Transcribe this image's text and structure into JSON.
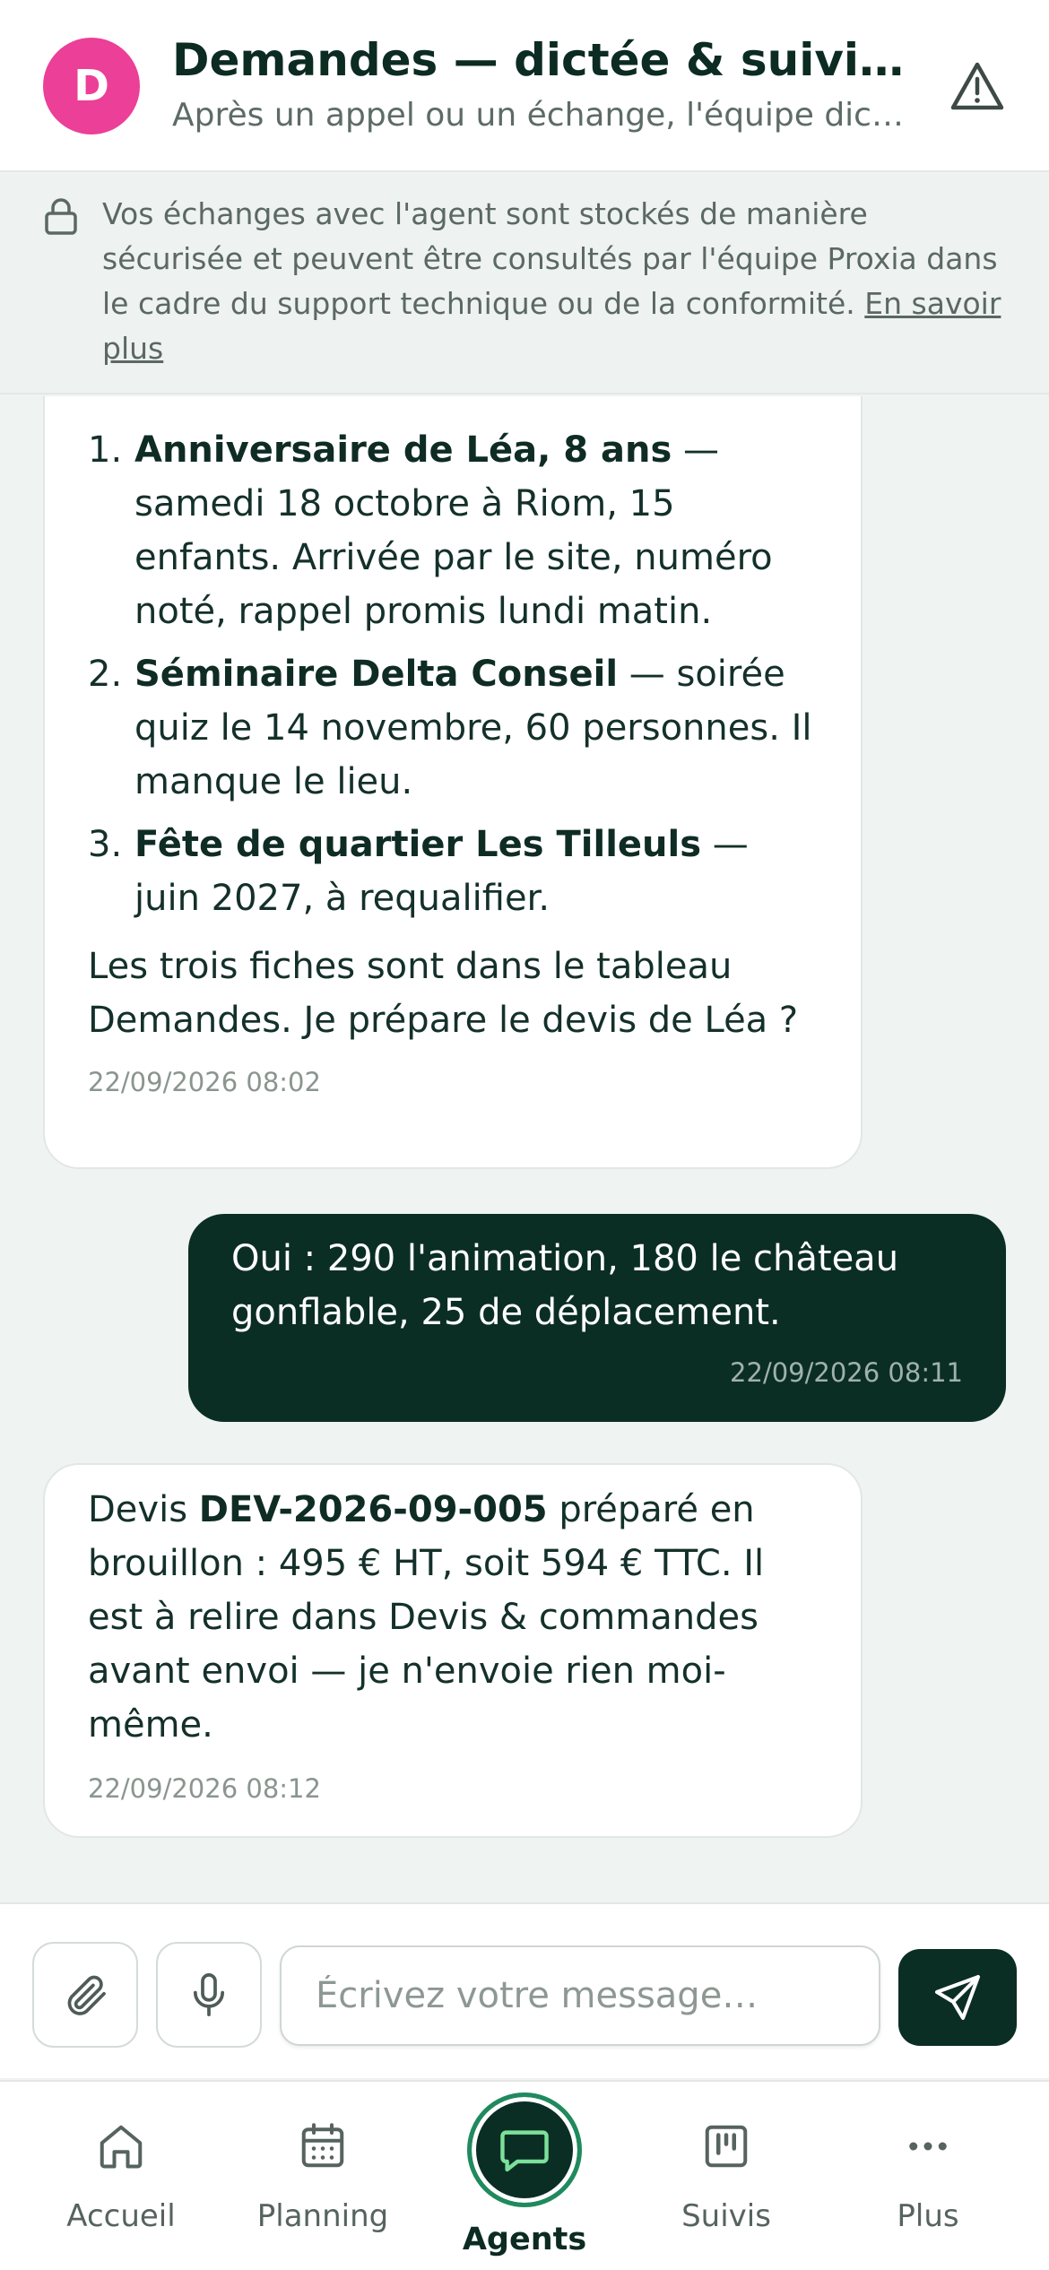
{
  "header": {
    "avatar_letter": "D",
    "avatar_color": "#ec3f97",
    "title": "Demandes — dictée & suivi …",
    "subtitle": "Après un appel ou un échange, l'équipe dict…"
  },
  "notice": {
    "text": "Vos échanges avec l'agent sont stockés de manière sécurisée et peuvent être consultés par l'équipe Proxia dans le cadre du support technique ou de la conformité. ",
    "link": "En savoir plus"
  },
  "messages": [
    {
      "items": [
        {
          "num": "1.",
          "bold": "Anniversaire de Léa, 8 ans",
          "rest": " — samedi 18 octobre à Riom, 15 enfants. Arrivée par le site, numéro noté, rappel promis lundi matin."
        },
        {
          "num": "2.",
          "bold": "Séminaire Delta Conseil",
          "rest": " — soirée quiz le 14 novembre, 60 personnes. Il manque le lieu."
        },
        {
          "num": "3.",
          "bold": "Fête de quartier Les Tilleuls",
          "rest": " — juin 2027, à requalifier."
        }
      ],
      "paragraph": "Les trois fiches sont dans le tableau Demandes. Je prépare le devis de Léa ?",
      "time": "22/09/2026 08:02"
    },
    {
      "text": "Oui : 290 l'animation, 180 le château gonflable, 25 de déplacement.",
      "time": "22/09/2026 08:11"
    },
    {
      "pre": "Devis ",
      "bold": "DEV-2026-09-005",
      "post": " préparé en brouillon : 495 € HT, soit 594 € TTC. Il est à relire dans Devis & commandes avant envoi — je n'envoie rien moi-même.",
      "time": "22/09/2026 08:12"
    }
  ],
  "composer": {
    "placeholder": "Écrivez votre message…"
  },
  "nav": {
    "items": [
      "Accueil",
      "Planning",
      "Agents",
      "Suivis",
      "Plus"
    ],
    "active": "Agents"
  },
  "colors": {
    "primary_dark": "#0b2e24",
    "active_ring": "#1f8a5e",
    "background": "#eff3f1"
  }
}
